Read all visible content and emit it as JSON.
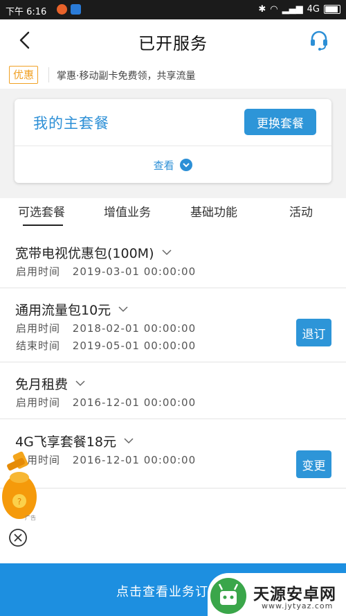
{
  "statusbar": {
    "time": "下午 6:16",
    "network": "4G"
  },
  "header": {
    "title": "已开服务"
  },
  "promo": {
    "badge": "优惠",
    "text": "掌惠·移动副卡免费领，共享流量"
  },
  "main_card": {
    "title": "我的主套餐",
    "change_button": "更换套餐",
    "view_label": "查看"
  },
  "tabs": [
    {
      "label": "可选套餐",
      "active": true
    },
    {
      "label": "增值业务",
      "active": false
    },
    {
      "label": "基础功能",
      "active": false
    },
    {
      "label": "活动",
      "active": false
    }
  ],
  "services": [
    {
      "name": "宽带电视优惠包(100M)",
      "start_label": "启用时间",
      "start": "2019-03-01  00:00:00"
    },
    {
      "name": "通用流量包10元",
      "start_label": "启用时间",
      "start": "2018-02-01  00:00:00",
      "end_label": "结束时间",
      "end": "2019-05-01  00:00:00",
      "action": "退订"
    },
    {
      "name": "免月租费",
      "start_label": "启用时间",
      "start": "2016-12-01  00:00:00"
    },
    {
      "name": "4G飞享套餐18元",
      "start_label": "启用时间",
      "start": "2016-12-01  00:00:00",
      "action": "变更"
    }
  ],
  "ad": {
    "label": "广告"
  },
  "bottom_bar": {
    "text": "点击查看业务订"
  },
  "watermark": {
    "name": "天源安卓网",
    "url": "www.jytyaz.com"
  },
  "colors": {
    "accent": "#2d95d8",
    "promo": "#f0a023",
    "bottom": "#1d8fe0"
  }
}
